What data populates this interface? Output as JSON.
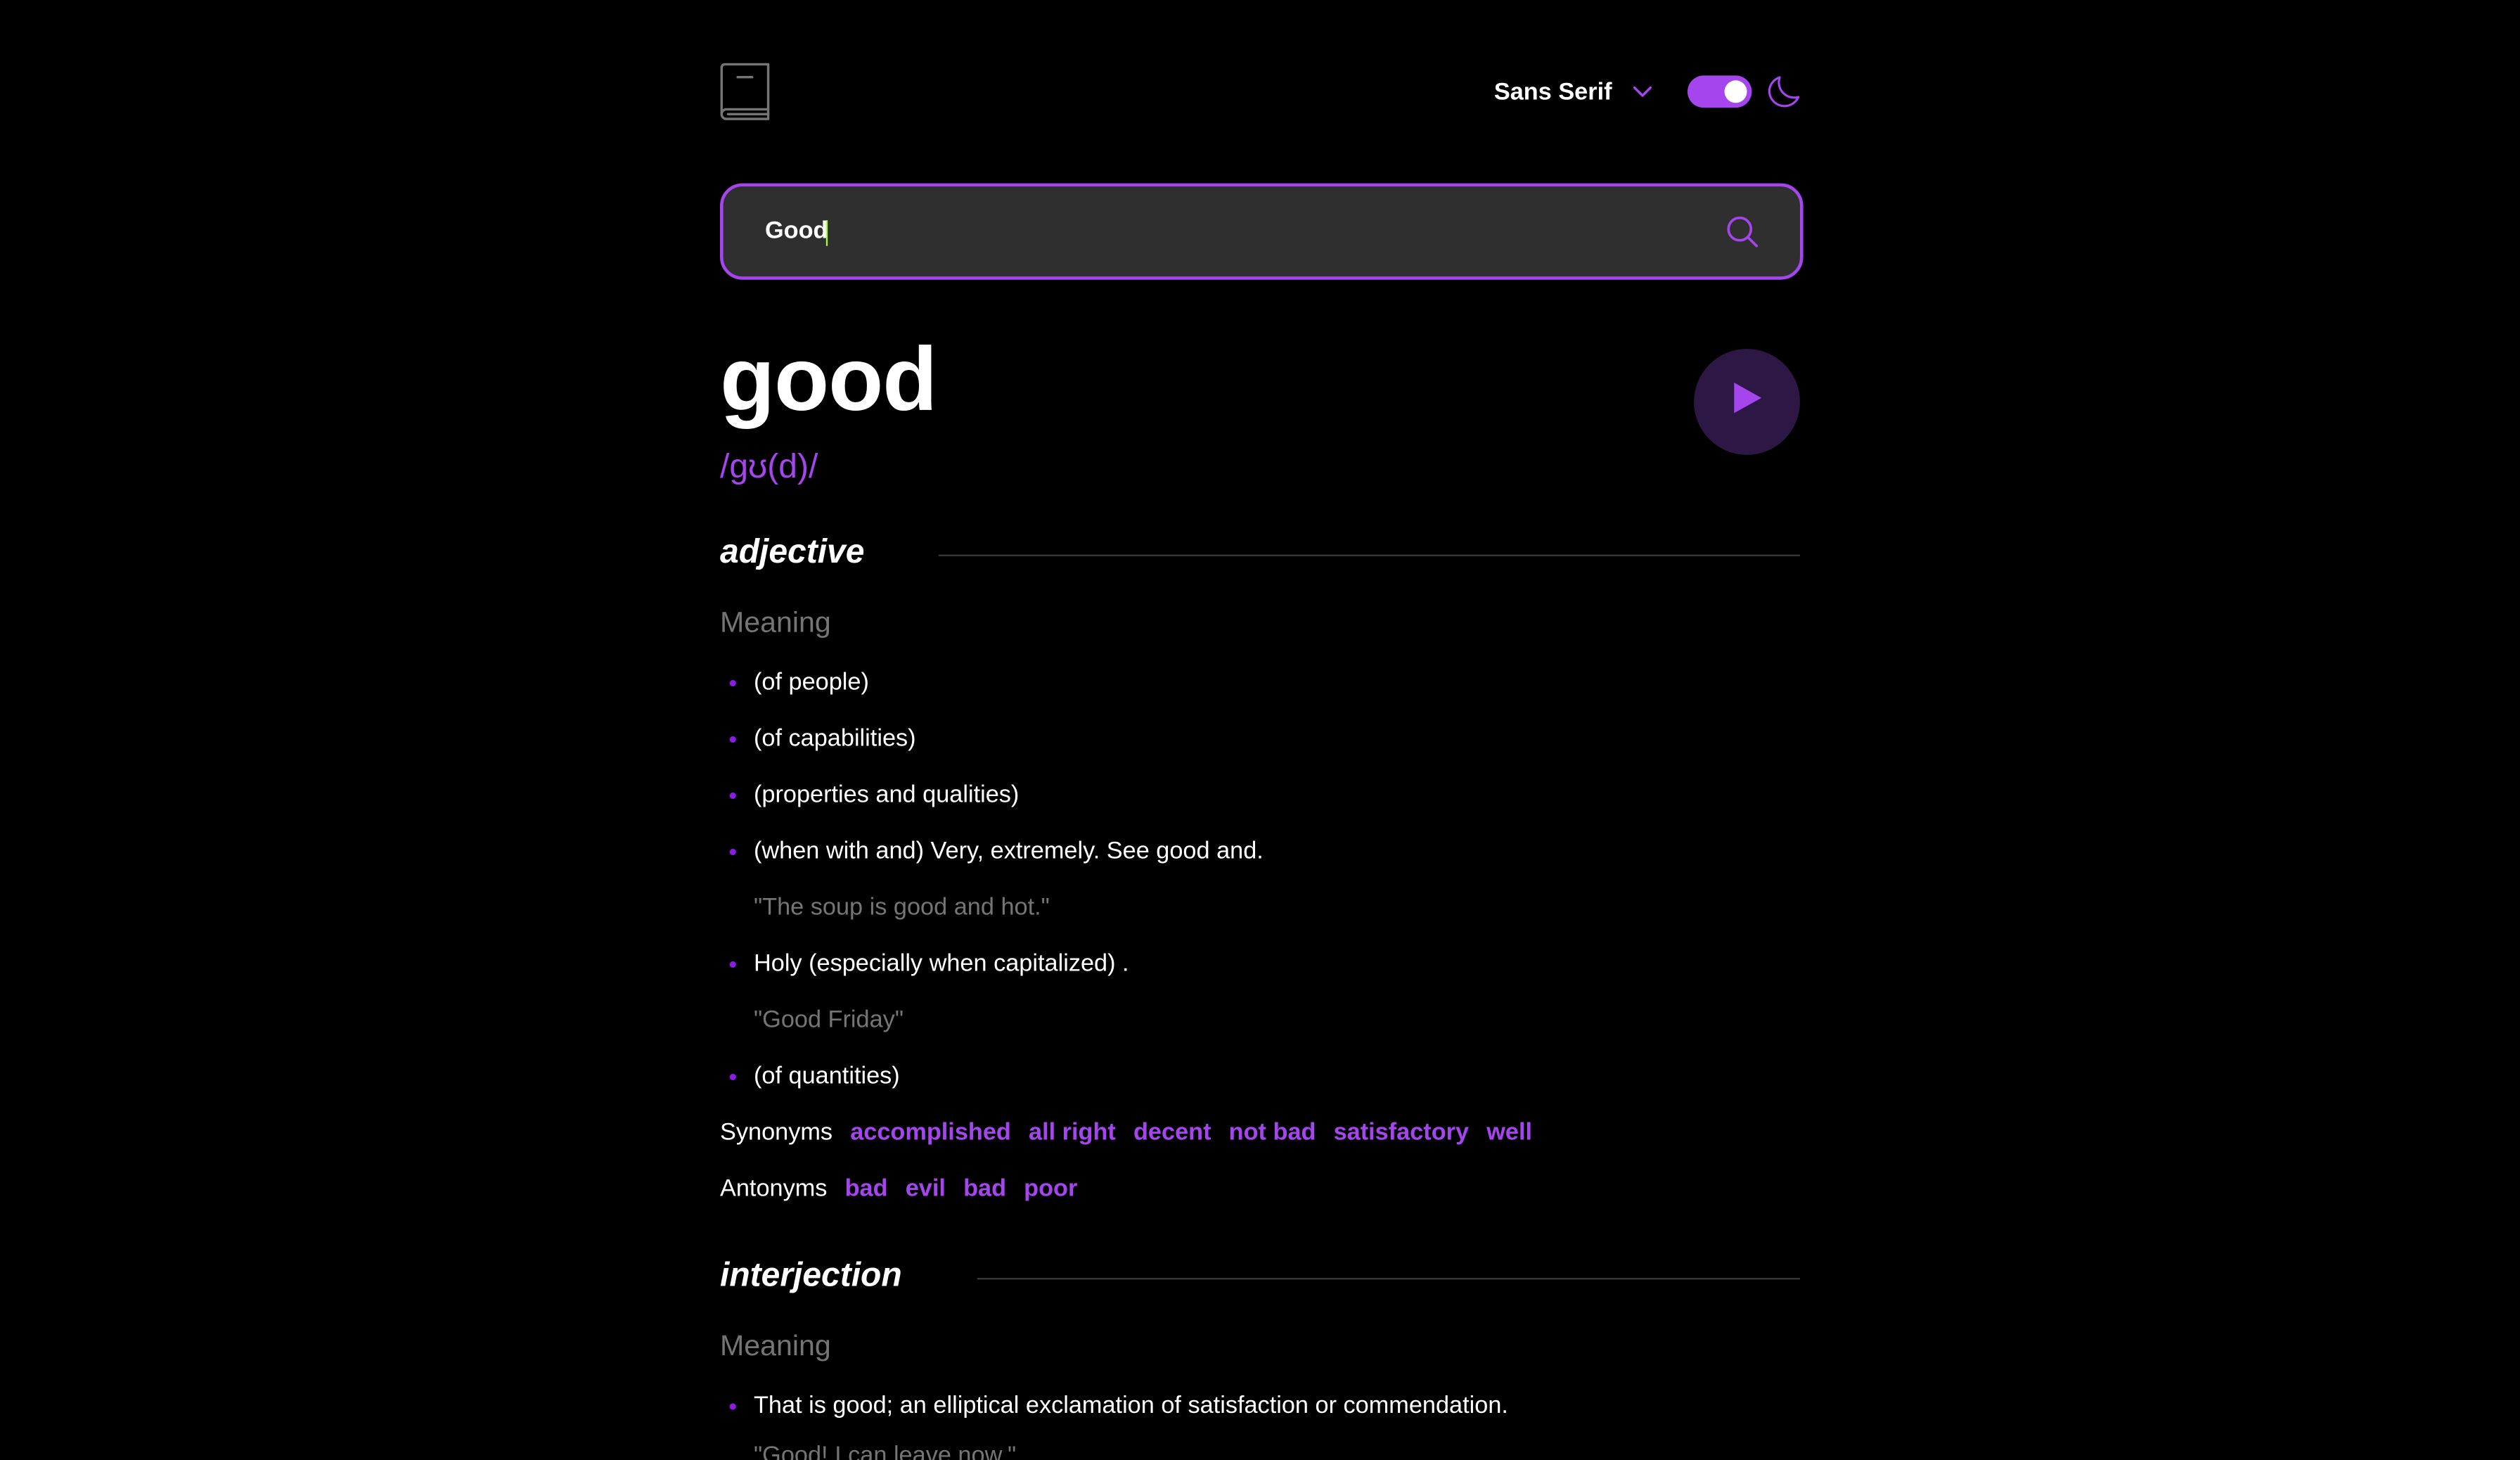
{
  "header": {
    "logo_icon": "book-icon",
    "font_selector": "Sans Serif",
    "chevron_icon": "chevron-down-icon",
    "theme_toggle_on": true,
    "moon_icon": "moon-icon"
  },
  "search": {
    "value": "Good",
    "icon": "search-icon"
  },
  "entry": {
    "word": "good",
    "phonetic": "/ɡʊ(d)/",
    "play_icon": "play-icon"
  },
  "meanings": [
    {
      "part_of_speech": "adjective",
      "meaning_label": "Meaning",
      "definitions": [
        {
          "text": "(of people)"
        },
        {
          "text": "(of capabilities)"
        },
        {
          "text": "(properties and qualities)"
        },
        {
          "text": "(when with and) Very, extremely. See good and.",
          "example": "\"The soup is good and hot.\""
        },
        {
          "text": "Holy (especially when capitalized) .",
          "example": "\"Good Friday\""
        },
        {
          "text": "(of quantities)"
        }
      ],
      "synonyms_label": "Synonyms",
      "synonyms": [
        "accomplished",
        "all right",
        "decent",
        "not bad",
        "satisfactory",
        "well"
      ],
      "antonyms_label": "Antonyms",
      "antonyms": [
        "bad",
        "evil",
        "bad",
        "poor"
      ]
    },
    {
      "part_of_speech": "interjection",
      "meaning_label": "Meaning",
      "definitions": [
        {
          "text": "That is good; an elliptical exclamation of satisfaction or commendation.",
          "example": "\"Good! I can leave now.\""
        }
      ]
    }
  ],
  "colors": {
    "accent": "#a445ed",
    "background": "#000000",
    "input_bg": "#2f2f2f",
    "muted": "#757575"
  }
}
